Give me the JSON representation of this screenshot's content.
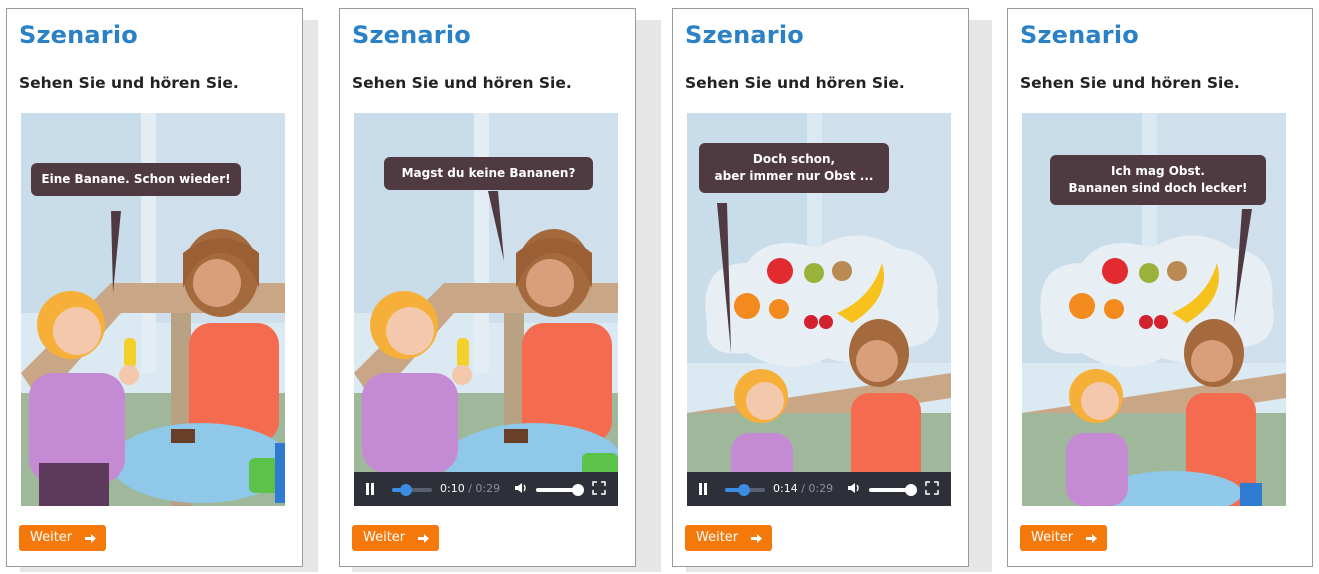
{
  "cards": [
    {
      "title": "Szenario",
      "instruction": "Sehen Sie und hören Sie.",
      "speech": "Eine Banane. Schon wieder!",
      "button": "Weiter"
    },
    {
      "title": "Szenario",
      "instruction": "Sehen Sie und hören Sie.",
      "speech": "Magst du keine Bananen?",
      "button": "Weiter",
      "player": {
        "current": "0:10",
        "separator": "/",
        "total": "0:29",
        "progress": 0.34,
        "volume": 1.0
      }
    },
    {
      "title": "Szenario",
      "instruction": "Sehen Sie und hören Sie.",
      "speech": "Doch schon,\naber immer nur Obst ...",
      "button": "Weiter",
      "player": {
        "current": "0:14",
        "separator": "/",
        "total": "0:29",
        "progress": 0.48,
        "volume": 1.0
      }
    },
    {
      "title": "Szenario",
      "instruction": "Sehen Sie und hören Sie.",
      "speech": "Ich mag Obst.\nBananen sind doch lecker!",
      "button": "Weiter"
    }
  ],
  "colors": {
    "title": "#2a81c6",
    "button": "#f5780a",
    "bubble": "#4e3a40",
    "player_bar": "#2d3038",
    "player_accent": "#3a8de0"
  },
  "icons": [
    "play-pause-icon",
    "volume-icon",
    "fullscreen-icon",
    "arrow-right-icon",
    "fruit-thought-cloud"
  ]
}
